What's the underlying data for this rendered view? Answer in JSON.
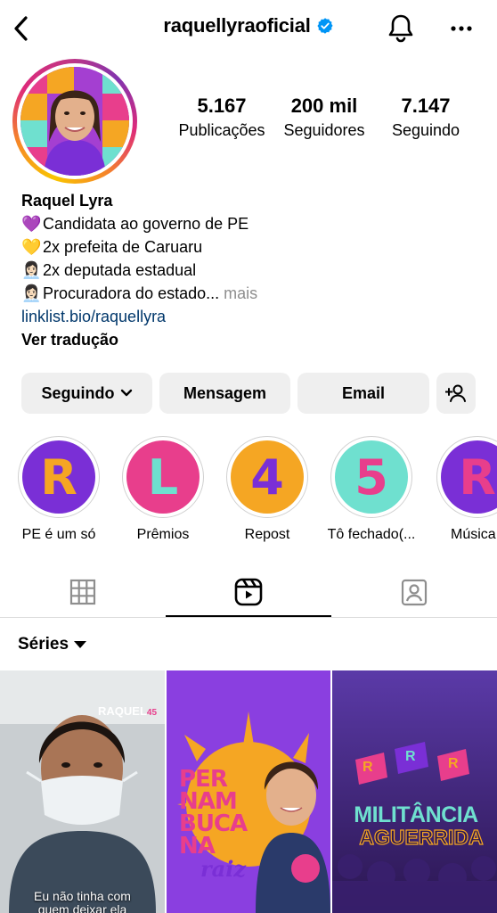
{
  "header": {
    "username": "raquellyraoficial",
    "back_icon": "chevron-left-icon",
    "verified_icon": "verified-badge-icon",
    "notifications_icon": "bell-icon",
    "more_icon": "ellipsis-icon"
  },
  "stats": [
    {
      "value": "5.167",
      "label": "Publicações"
    },
    {
      "value": "200 mil",
      "label": "Seguidores"
    },
    {
      "value": "7.147",
      "label": "Seguindo"
    }
  ],
  "bio": {
    "name": "Raquel Lyra",
    "lines": [
      {
        "emoji": "💜",
        "text": "Candidata ao governo de PE"
      },
      {
        "emoji": "💛",
        "text": "2x prefeita de Caruaru"
      },
      {
        "emoji": "👩🏻‍💼",
        "text": "2x deputada estadual"
      },
      {
        "emoji": "👩🏻‍💼",
        "text": "Procuradora do estado..."
      }
    ],
    "more": "mais",
    "link": "linklist.bio/raquellyra",
    "translate": "Ver tradução"
  },
  "actions": {
    "following": "Seguindo",
    "message": "Mensagem",
    "email": "Email"
  },
  "highlights": [
    {
      "label": "PE é um só",
      "glyph": "R",
      "bg": "#7a2fd6",
      "fg": "#f5a623"
    },
    {
      "label": "Prêmios",
      "glyph": "L",
      "bg": "#e83e8c",
      "fg": "#6fe0cf"
    },
    {
      "label": "Repost",
      "glyph": "4",
      "bg": "#f5a623",
      "fg": "#7a2fd6"
    },
    {
      "label": "Tô fechado(...",
      "glyph": "5",
      "bg": "#6fe0cf",
      "fg": "#e83e8c"
    },
    {
      "label": "Música",
      "glyph": "R",
      "bg": "#7a2fd6",
      "fg": "#e83e8c"
    }
  ],
  "tabs": [
    {
      "name": "posts-grid",
      "icon": "grid-icon",
      "active": false
    },
    {
      "name": "reels",
      "icon": "reels-icon",
      "active": true
    },
    {
      "name": "tagged",
      "icon": "tagged-person-icon",
      "active": false
    }
  ],
  "series": {
    "label": "Séries"
  },
  "tiles": [
    {
      "brand": "RAQUEL",
      "brand_num": "45",
      "caption_line1": "Eu não tinha com",
      "caption_line2": "quem deixar ela"
    },
    {
      "headline": [
        "PER",
        "NAM",
        "BUCA",
        "NA"
      ],
      "sub": "raiz"
    },
    {
      "headline_top": "MILITÂNCIA",
      "headline_bottom": "AGUERRIDA",
      "flag_letter": "R"
    }
  ],
  "colors": {
    "accent_blue": "#0095f6",
    "link": "#00376b",
    "button_bg": "#efefef",
    "purple": "#7a2fd6",
    "pink": "#e83e8c",
    "orange": "#f5a623",
    "teal": "#6fe0cf"
  }
}
